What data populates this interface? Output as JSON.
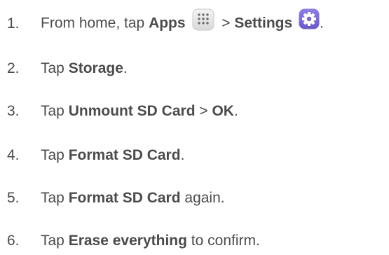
{
  "steps": [
    {
      "number": "1.",
      "parts": {
        "a": "From home, tap ",
        "b": "Apps",
        "c": " > ",
        "d": "Settings"
      },
      "icons": [
        "apps-icon",
        "settings-icon"
      ]
    },
    {
      "number": "2.",
      "parts": {
        "a": "Tap ",
        "b": "Storage",
        "c": "."
      }
    },
    {
      "number": "3.",
      "parts": {
        "a": "Tap ",
        "b": "Unmount SD Card",
        "c": " > ",
        "d": "OK",
        "e": "."
      }
    },
    {
      "number": "4.",
      "parts": {
        "a": "Tap ",
        "b": "Format SD Card",
        "c": "."
      }
    },
    {
      "number": "5.",
      "parts": {
        "a": "Tap ",
        "b": "Format SD Card",
        "c": " again."
      }
    },
    {
      "number": "6.",
      "parts": {
        "a": "Tap ",
        "b": "Erase everything",
        "c": " to confirm."
      }
    }
  ],
  "colors": {
    "text": "#4b4b4b",
    "settings_icon": "#7b68d8"
  }
}
